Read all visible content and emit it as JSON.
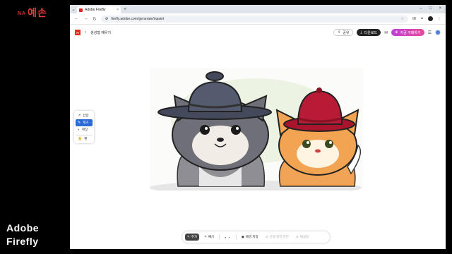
{
  "overlay": {
    "badge_prefix": "NA",
    "badge_text": "예손",
    "brand_line1": "Adobe",
    "brand_line2": "Firefly"
  },
  "browser": {
    "tab_title": "Adobe Firefly",
    "tab_close": "×",
    "new_tab": "+",
    "url": "firefly.adobe.com/generate/inpaint",
    "minimize": "–",
    "maximize": "□",
    "close": "×"
  },
  "app": {
    "logo": "Fi",
    "page_title": "생성형 채우기",
    "share_label": "공유",
    "download_label": "다운로드",
    "buy_label": "지금 구매하기"
  },
  "tools": [
    {
      "icon": "↗",
      "label": "삽입"
    },
    {
      "icon": "✎",
      "label": "제거"
    },
    {
      "icon": "◐",
      "label": "확장"
    },
    {
      "icon": "✋",
      "label": "팬"
    }
  ],
  "bottombar": {
    "add": "추가",
    "subtract": "빼기",
    "brush_label": "◐",
    "brush_chevron": "⌄",
    "bg_label": "배경 지정",
    "invert_label": "선택 영역 반전",
    "clear_label": "재설정"
  },
  "colors": {
    "accent": "#2c6bd6",
    "brand_red": "#e4281d"
  }
}
